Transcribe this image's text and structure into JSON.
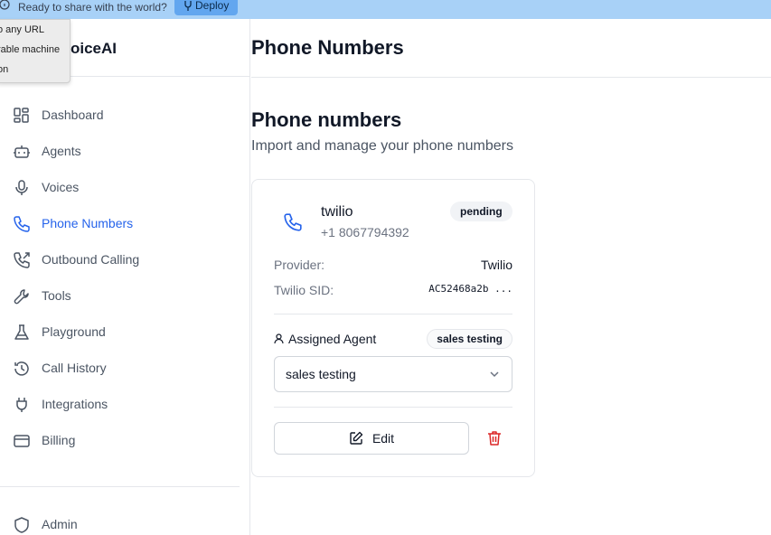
{
  "banner": {
    "text": "Ready to share with the world?",
    "deploy_label": "Deploy"
  },
  "popup": {
    "items": [
      "o any URL",
      "rable machine",
      "on"
    ]
  },
  "sidebar": {
    "logo": "oiceAI",
    "items": [
      {
        "label": "Dashboard",
        "icon": "dashboard-icon"
      },
      {
        "label": "Agents",
        "icon": "bot-icon"
      },
      {
        "label": "Voices",
        "icon": "mic-icon"
      },
      {
        "label": "Phone Numbers",
        "icon": "phone-icon",
        "active": true
      },
      {
        "label": "Outbound Calling",
        "icon": "phone-outgoing-icon"
      },
      {
        "label": "Tools",
        "icon": "wrench-icon"
      },
      {
        "label": "Playground",
        "icon": "flask-icon"
      },
      {
        "label": "Call History",
        "icon": "history-icon"
      },
      {
        "label": "Integrations",
        "icon": "plug-icon"
      },
      {
        "label": "Billing",
        "icon": "credit-card-icon"
      }
    ],
    "admin_label": "Admin"
  },
  "header": {
    "title": "Phone Numbers"
  },
  "main": {
    "section_title": "Phone numbers",
    "section_subtitle": "Import and manage your phone numbers",
    "card": {
      "provider_name": "twilio",
      "phone_number": "+1 8067794392",
      "status": "pending",
      "provider_label": "Provider:",
      "provider_value": "Twilio",
      "sid_label": "Twilio SID:",
      "sid_value": "AC52468a2b ...",
      "assigned_label": "Assigned Agent",
      "assigned_badge": "sales testing",
      "select_value": "sales testing",
      "edit_label": "Edit"
    }
  },
  "colors": {
    "accent": "#2563eb",
    "banner": "#a8d1f7",
    "danger": "#dc2626"
  }
}
